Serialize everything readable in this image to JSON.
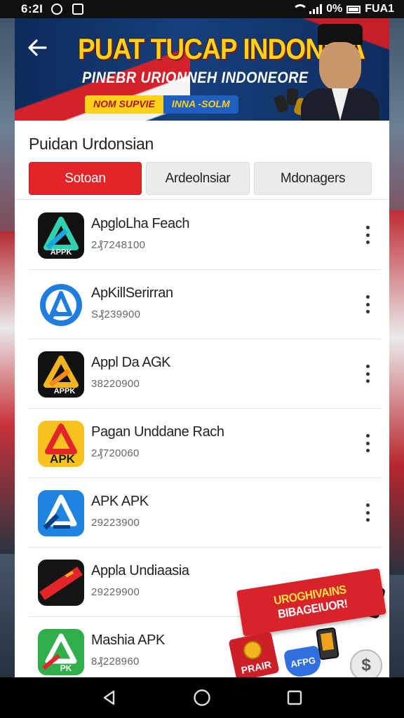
{
  "status_bar": {
    "time": "6:2Ɩ",
    "battery_text": "0%",
    "carrier_text": "FUA1"
  },
  "banner": {
    "title": "PUAT TUCAP INDONSIA",
    "subtitle": "PINEBR URIONNEH INDONEORE",
    "pill_left": "NOM SUPVIE",
    "pill_right": "INNA -SOLM"
  },
  "section_title": "Puidan Urdonsian",
  "tabs": [
    {
      "label": "Sotoan",
      "active": true
    },
    {
      "label": "Ardeolnsiar",
      "active": false
    },
    {
      "label": "Mdonagers",
      "active": false
    }
  ],
  "apps": [
    {
      "name": "ApgloLha Feach",
      "meta": "2₰7248100",
      "icon": "apk-triangle-teal-icon",
      "icon_text": "APPK"
    },
    {
      "name": "ApKillSerirran",
      "meta": "S₰239900",
      "icon": "apk-blue-circle-icon",
      "icon_text": ""
    },
    {
      "name": "Appl Da AᏀK",
      "meta": "38220900",
      "icon": "apk-gold-triangle-icon",
      "icon_text": "APPK"
    },
    {
      "name": "Pagan Unddane Rach",
      "meta": "2₰720060",
      "icon": "apk-yellow-red-icon",
      "icon_text": "APK"
    },
    {
      "name": "APK APK",
      "meta": "29223900",
      "icon": "apk-blue-square-icon",
      "icon_text": ""
    },
    {
      "name": "Appla Undiaasia",
      "meta": "29229900",
      "icon": "apk-black-red-icon",
      "icon_text": ""
    },
    {
      "name": "Mashia APK",
      "meta": "8₰228960",
      "icon": "apk-green-triangle-icon",
      "icon_text": "PK"
    }
  ],
  "promo": {
    "line1": "UROGHIVAINS",
    "line2": "BIBAGEIUOR!",
    "tile_text": "PRAIR",
    "gem_text": "AFPG",
    "dollar": "$"
  },
  "colors": {
    "accent_red": "#e32529",
    "banner_blue": "#16407d",
    "banner_yellow": "#ffd11a"
  }
}
